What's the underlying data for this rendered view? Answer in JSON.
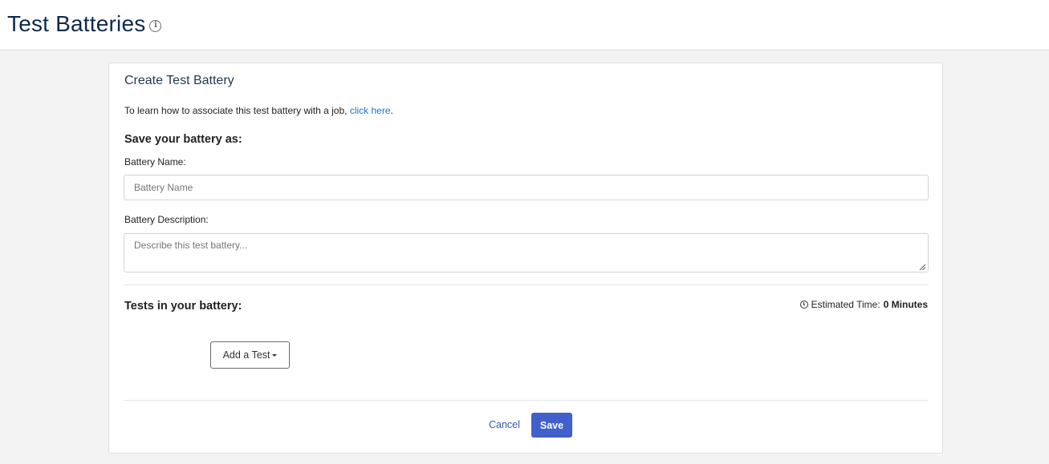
{
  "header": {
    "title": "Test Batteries",
    "info_icon": "info-icon"
  },
  "card": {
    "title": "Create Test Battery",
    "intro_text": "To learn how to associate this test battery with a job, ",
    "intro_link": "click here",
    "intro_end": ".",
    "save_heading": "Save your battery as:",
    "name_label": "Battery Name:",
    "name_placeholder": "Battery Name",
    "name_value": "",
    "description_label": "Battery Description:",
    "description_placeholder": "Describe this test battery...",
    "description_value": "",
    "tests_heading": "Tests in your battery:",
    "estimated_label": "Estimated Time:",
    "estimated_value": "0 Minutes",
    "clock_icon": "clock-icon",
    "add_test_label": "Add a Test",
    "caret_icon": "chevron-down-icon",
    "cancel_label": "Cancel",
    "save_label": "Save"
  },
  "colors": {
    "title": "#0f2a4d",
    "link": "#1a73c8",
    "primary_button": "#4160c9",
    "background": "#f3f3f3"
  }
}
